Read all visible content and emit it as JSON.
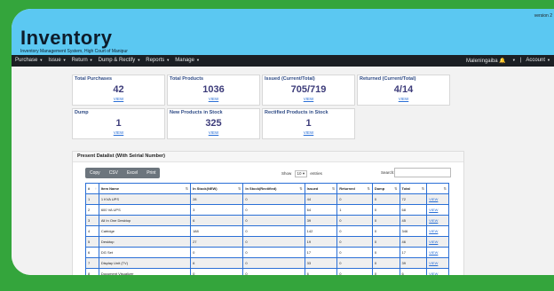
{
  "header": {
    "title": "Inventory",
    "subtitle": "Inventory Management System, High Court of Manipur",
    "version": "version 2"
  },
  "nav": {
    "items": [
      "Purchase",
      "Issue",
      "Return",
      "Dump & Rectify",
      "Reports",
      "Manage"
    ],
    "user": "Maleningaiba",
    "separator": "|",
    "account": "Account"
  },
  "cards": [
    {
      "label": "Total Purchases",
      "value": "42",
      "link": "VIEW"
    },
    {
      "label": "Total Products",
      "value": "1036",
      "link": "VIEW"
    },
    {
      "label": "Issued (Current/Total)",
      "value": "705/719",
      "link": "VIEW"
    },
    {
      "label": "Returned (Current/Total)",
      "value": "4/14",
      "link": "VIEW"
    },
    {
      "label": "Dump",
      "value": "1",
      "link": "VIEW"
    },
    {
      "label": "New Products in Stock",
      "value": "325",
      "link": "VIEW"
    },
    {
      "label": "Rectified Products in Stock",
      "value": "1",
      "link": "VIEW"
    }
  ],
  "panel": {
    "title": "Present Datalist (With Seirial Number)",
    "buttons": [
      "Copy",
      "CSV",
      "Excel",
      "Print"
    ],
    "show_label": "Show",
    "show_value": "10",
    "entries_label": "entries",
    "search_label": "Search:"
  },
  "table": {
    "headers": [
      "#",
      "Item Name",
      "In Stock(NEW)",
      "In Stock(Rectified)",
      "Issued",
      "Returned",
      "Dump",
      "Total",
      ""
    ],
    "rows": [
      [
        "1",
        "1 KVA UPS",
        "28",
        "0",
        "44",
        "0",
        "0",
        "72",
        "VIEW"
      ],
      [
        "2",
        "600 VA UPS",
        "3",
        "0",
        "64",
        "1",
        "0",
        "68",
        "VIEW"
      ],
      [
        "3",
        "All In One Desktop",
        "6",
        "0",
        "39",
        "0",
        "0",
        "45",
        "VIEW"
      ],
      [
        "4",
        "Catridge",
        "188",
        "0",
        "142",
        "0",
        "0",
        "346",
        "VIEW"
      ],
      [
        "5",
        "Desktop",
        "27",
        "0",
        "19",
        "0",
        "0",
        "46",
        "VIEW"
      ],
      [
        "6",
        "DG Set",
        "0",
        "0",
        "17",
        "0",
        "0",
        "17",
        "VIEW"
      ],
      [
        "7",
        "Display Unit (TV)",
        "6",
        "0",
        "33",
        "0",
        "0",
        "39",
        "VIEW"
      ],
      [
        "8",
        "Document Visualizer",
        "0",
        "0",
        "6",
        "0",
        "0",
        "6",
        "VIEW"
      ]
    ]
  }
}
